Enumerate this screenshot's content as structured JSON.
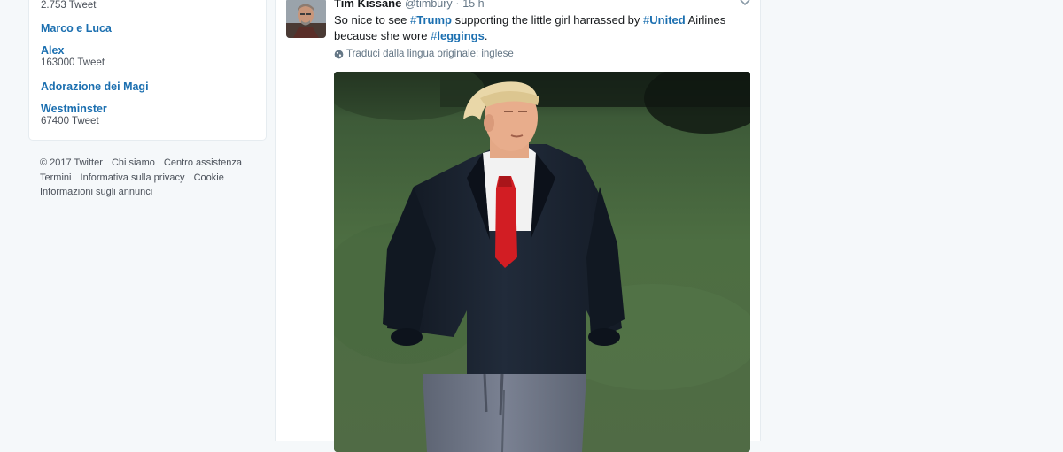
{
  "trends": [
    {
      "name": "",
      "count": "2.753 Tweet"
    },
    {
      "name": "Marco e Luca",
      "count": ""
    },
    {
      "name": "Alex",
      "count": "163000 Tweet"
    },
    {
      "name": "Adorazione dei Magi",
      "count": ""
    },
    {
      "name": "Westminster",
      "count": "67400 Tweet"
    }
  ],
  "footer": {
    "copyright": "© 2017 Twitter",
    "about": "Chi siamo",
    "help": "Centro assistenza",
    "terms": "Termini",
    "privacy": "Informativa sulla privacy",
    "cookie": "Cookie",
    "ads": "Informazioni sugli annunci"
  },
  "tweet": {
    "author_name": "Tim Kissane",
    "author_handle": "@timbury",
    "dot": "·",
    "time": "15 h",
    "text": {
      "p1": "So nice to see ",
      "h1_hash": "#",
      "h1_word": "Trump",
      "p2": " supporting the little girl harrassed by ",
      "h2_hash": "#",
      "h2_word": "United",
      "p3": " Airlines because she wore ",
      "h3_hash": "#",
      "h3_word": "leggings",
      "p4": "."
    },
    "translate_label": "Traduci dalla lingua originale: inglese"
  },
  "icons": {
    "caret": "chevron-down-icon",
    "globe": "globe-icon"
  },
  "colors": {
    "link": "#1b6fb0",
    "background": "#f5f8fa",
    "card": "#ffffff",
    "tie": "#d21d23",
    "jacket": "#1c2330",
    "pants": "#6d7484"
  }
}
